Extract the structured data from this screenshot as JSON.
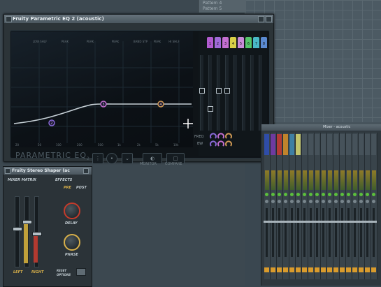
{
  "background": {
    "patterns": [
      "Pattern 4",
      "Pattern 5"
    ]
  },
  "eq_window": {
    "title": "Fruity Parametric EQ 2 (acoustic)",
    "band_labels": [
      "LOW SHLF",
      "PEAK",
      "PEAK",
      "PEAK",
      "BAND STP",
      "PEAK",
      "HI SHLF"
    ],
    "freq_labels": [
      "20",
      "50",
      "100",
      "200",
      "500",
      "1k",
      "2k",
      "5k",
      "10k"
    ],
    "band_buttons": [
      {
        "label": "1",
        "color": "#b25bd0"
      },
      {
        "label": "2",
        "color": "#a06ad8"
      },
      {
        "label": "3",
        "color": "#c46fd1"
      },
      {
        "label": "4",
        "color": "#d8d047"
      },
      {
        "label": "5",
        "color": "#c98ad8"
      },
      {
        "label": "6",
        "color": "#55c46a"
      },
      {
        "label": "7",
        "color": "#49b9c7"
      },
      {
        "label": "8",
        "color": "#5a8ad2"
      }
    ],
    "logo": "PARAMETRIC EQ",
    "logo_sub": "2",
    "monitor_label": "MONITOR",
    "compare_label": "COMPARE",
    "freq_label": "FREQ",
    "bw_label": "BW",
    "nodes": [
      "2",
      "3",
      "4"
    ],
    "colors": {
      "curve": "#c6d0d6",
      "accent": "#5a4fd0"
    }
  },
  "stereo_shaper": {
    "title": "Fruity Stereo Shaper (ac",
    "mixer_matrix": "MIXER MATRIX",
    "effects": "EFFECTS",
    "pre": "PRE",
    "post": "POST",
    "delay_label": "DELAY",
    "phase_label": "PHASE",
    "left_label": "LEFT",
    "right_label": "RIGHT",
    "reset_label": "RESET",
    "options_label": "OPTIONS"
  },
  "mixer": {
    "title": "Mixer - acoustic",
    "strip_colors": [
      "#2f4da8",
      "#6e3aa0",
      "#b33a35",
      "#c0832c",
      "#3f7fa3",
      "#c2c46c",
      "#46525a",
      "#46525a",
      "#46525a",
      "#46525a",
      "#46525a",
      "#46525a",
      "#46525a",
      "#46525a",
      "#46525a",
      "#46525a",
      "#46525a",
      "#46525a",
      "#46525a",
      "#46525a"
    ]
  }
}
